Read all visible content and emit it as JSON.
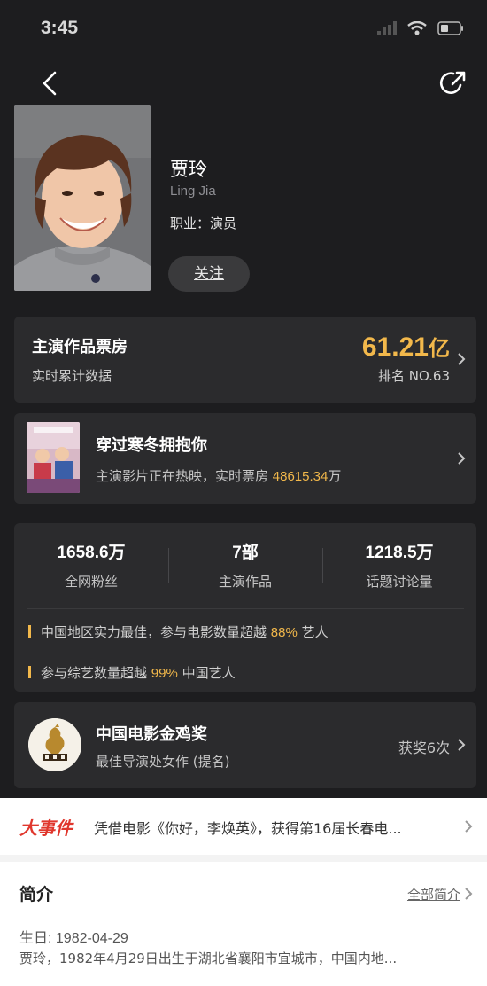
{
  "status_bar": {
    "time": "3:45"
  },
  "profile": {
    "name": "贾玲",
    "english_name": "Ling Jia",
    "occupation": "职业：演员",
    "follow_label": "关注"
  },
  "box_office": {
    "title": "主演作品票房",
    "subtitle": "实时累计数据",
    "amount": "61.21",
    "unit": "亿",
    "rank": "排名 NO.63"
  },
  "now_showing": {
    "title": "穿过寒冬拥抱你",
    "subtitle_prefix": "主演影片正在热映，实时票房 ",
    "gross": "48615.34",
    "gross_unit": "万"
  },
  "stats": [
    {
      "value": "1658.6万",
      "label": "全网粉丝"
    },
    {
      "value": "7部",
      "label": "主演作品"
    },
    {
      "value": "1218.5万",
      "label": "话题讨论量"
    }
  ],
  "facts": [
    {
      "prefix": "中国地区实力最佳，参与电影数量超越 ",
      "highlight": "88%",
      "suffix": " 艺人"
    },
    {
      "prefix": "参与综艺数量超越 ",
      "highlight": "99%",
      "suffix": " 中国艺人"
    }
  ],
  "award": {
    "title": "中国电影金鸡奖",
    "subtitle": "最佳导演处女作 (提名)",
    "count": "获奖6次"
  },
  "events": {
    "tag": "大事件",
    "text": "凭借电影《你好，李焕英》，获得第16届长春电..."
  },
  "intro": {
    "title": "简介",
    "more": "全部简介",
    "birth": "生日: 1982-04-29",
    "desc": "贾玲，1982年4月29日出生于湖北省襄阳市宜城市，中国内地..."
  },
  "colors": {
    "accent": "#f2b84b",
    "event_red": "#e0372d",
    "card_bg": "#2b2b2d",
    "page_bg": "#1d1d1f"
  }
}
